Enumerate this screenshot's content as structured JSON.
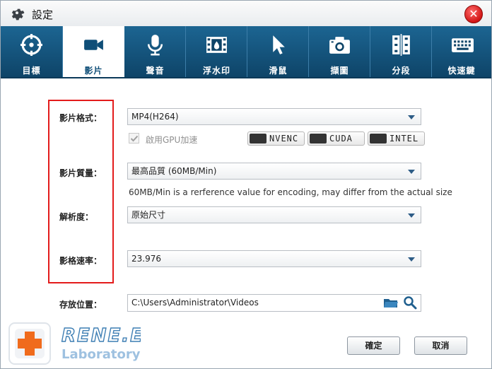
{
  "window": {
    "title": "設定",
    "close_glyph": "✕"
  },
  "tabs": [
    {
      "label": "目標",
      "icon": "target-icon"
    },
    {
      "label": "影片",
      "icon": "video-camera-icon",
      "active": true
    },
    {
      "label": "聲音",
      "icon": "microphone-icon"
    },
    {
      "label": "浮水印",
      "icon": "filmstrip-icon"
    },
    {
      "label": "滑鼠",
      "icon": "mouse-cursor-icon"
    },
    {
      "label": "擷圖",
      "icon": "camera-icon"
    },
    {
      "label": "分段",
      "icon": "segment-icon"
    },
    {
      "label": "快速鍵",
      "icon": "keyboard-icon"
    }
  ],
  "video": {
    "format_label": "影片格式：",
    "format_value": "MP4(H264)",
    "gpu_checkbox_label": "啟用GPU加速",
    "gpu_checked": true,
    "badges": [
      "NVENC",
      "CUDA",
      "INTEL"
    ],
    "quality_label": "影片質量：",
    "quality_value": "最高品質 (60MB/Min)",
    "quality_hint": "60MB/Min is a rerference value for encoding, may differ from the actual size",
    "resolution_label": "解析度：",
    "resolution_value": "原始尺寸",
    "fps_label": "影格速率：",
    "fps_value": "23.976",
    "save_label": "存放位置：",
    "save_path": "C:\\Users\\Administrator\\Videos"
  },
  "buttons": {
    "ok": "確定",
    "cancel": "取消"
  },
  "logo": {
    "line1": "RENE.E",
    "line2": "Laboratory"
  },
  "colors": {
    "accent": "#0f4e78",
    "tabbar": "#1c6592",
    "highlight_box": "#e31b1b"
  }
}
